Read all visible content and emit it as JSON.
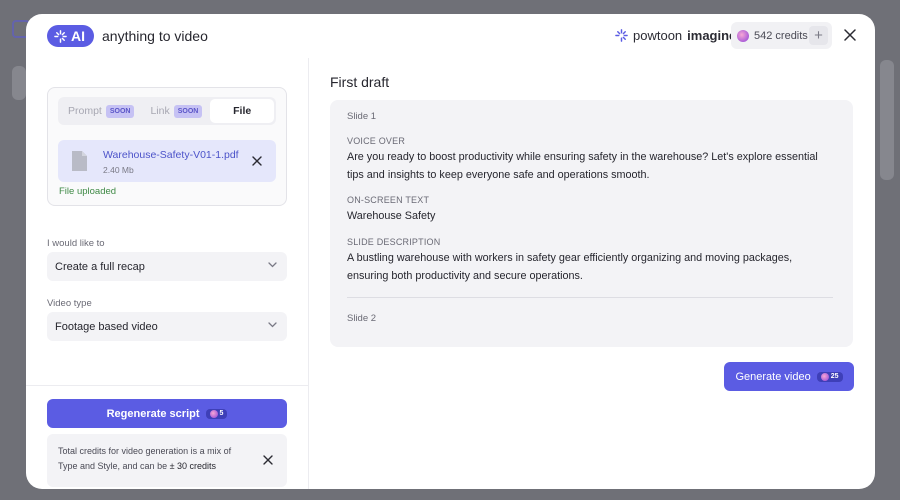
{
  "brand": {
    "ai_badge": "AI",
    "title": "anything to video",
    "partner_prefix": "powtoon",
    "partner_name": "imagine"
  },
  "credits": {
    "label": "542 credits",
    "add_icon": "plus-icon"
  },
  "colors": {
    "accent": "#5b5ce3",
    "link": "#4c53c9",
    "success": "#3f8a46",
    "panel_bg": "#f3f3f6"
  },
  "source_tabs": [
    {
      "label": "Prompt",
      "badge": "SOON",
      "active": false
    },
    {
      "label": "Link",
      "badge": "SOON",
      "active": false
    },
    {
      "label": "File",
      "badge": "",
      "active": true
    }
  ],
  "file": {
    "name": "Warehouse-Safety-V01-1.pdf",
    "size": "2.40 Mb",
    "status": "File uploaded"
  },
  "goal": {
    "label": "I would like to",
    "value": "Create a full recap"
  },
  "video_type": {
    "label": "Video type",
    "value": "Footage based video"
  },
  "regenerate": {
    "label": "Regenerate script",
    "cost": "5"
  },
  "info": {
    "text_before": "Total credits for video generation is a mix of Type and Style, and can be ",
    "highlight": "± 30 credits"
  },
  "draft": {
    "title": "First draft",
    "slides": [
      {
        "label": "Slide 1",
        "voice_over_label": "VOICE OVER",
        "voice_over": "Are you ready to boost productivity while ensuring safety in the warehouse? Let's explore essential tips and insights to keep everyone safe and operations smooth.",
        "on_screen_label": "ON-SCREEN TEXT",
        "on_screen": "Warehouse Safety",
        "description_label": "SLIDE DESCRIPTION",
        "description": "A bustling warehouse with workers in safety gear efficiently organizing and moving packages, ensuring both productivity and secure operations."
      },
      {
        "label": "Slide 2"
      }
    ]
  },
  "generate": {
    "label": "Generate video",
    "cost": "25"
  }
}
